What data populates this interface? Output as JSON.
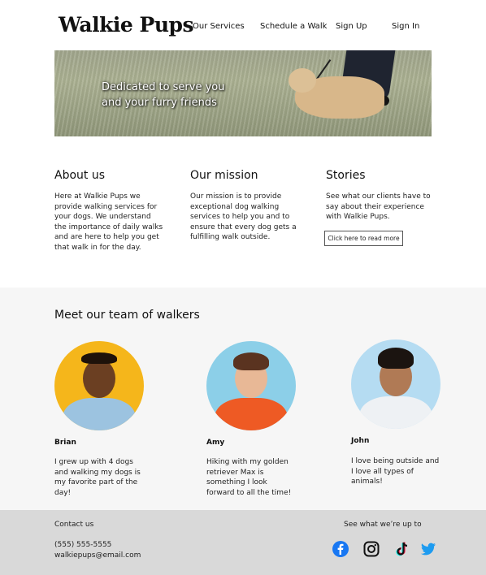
{
  "header": {
    "logo": "Walkie Pups",
    "nav": [
      "Our Services",
      "Schedule a Walk",
      "Sign Up",
      "Sign In"
    ]
  },
  "hero": {
    "tagline_line1": "Dedicated to serve you",
    "tagline_line2": "and your furry friends"
  },
  "about": {
    "title": "About us",
    "text": "Here at Walkie Pups we provide walking services for your dogs. We understand the importance of daily walks and are here to help you get that walk in for the day."
  },
  "mission": {
    "title": "Our mission",
    "text": "Our mission is to provide exceptional dog walking services to help you and to ensure that every dog gets a fulfilling walk outside."
  },
  "stories": {
    "title": "Stories",
    "text": "See what our clients have to say about their experience with Walkie Pups.",
    "button": "Click here to read more"
  },
  "team": {
    "title": "Meet our team of walkers",
    "members": [
      {
        "name": "Brian",
        "bio": "I grew up with 4 dogs and walking my dogs is my favorite part of the day!"
      },
      {
        "name": "Amy",
        "bio": "Hiking with my golden retriever Max is something I look forward to all the time!"
      },
      {
        "name": "John",
        "bio": "I love being outside and I love all types of animals!"
      }
    ]
  },
  "footer": {
    "contact_title": "Contact us",
    "phone": "(555) 555-5555",
    "email": "walkiepups@email.com",
    "social_title": "See what we’re up to",
    "social_icons": [
      "facebook-icon",
      "instagram-icon",
      "tiktok-icon",
      "twitter-icon"
    ]
  },
  "colors": {
    "team_bg": "#f6f6f6",
    "footer_bg": "#d9d9d9",
    "facebook": "#1877f2",
    "twitter": "#1d9bf0"
  }
}
